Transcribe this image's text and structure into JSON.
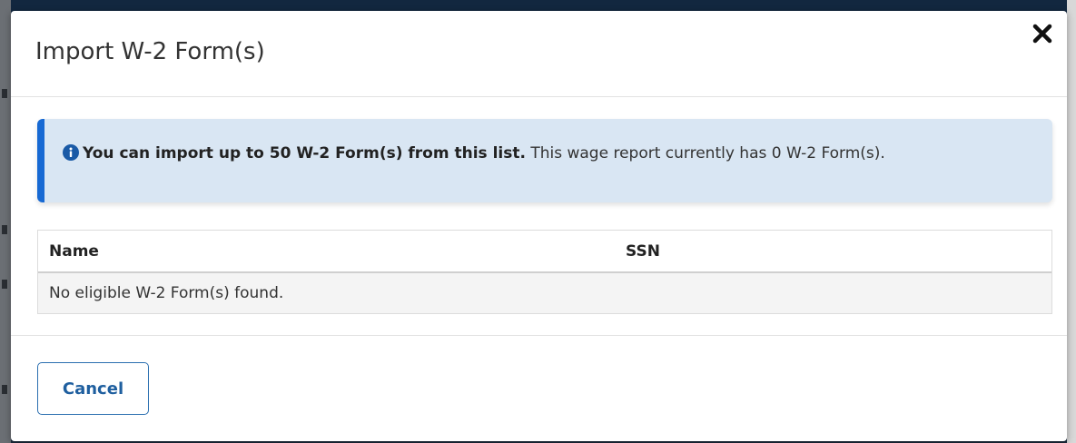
{
  "dialog": {
    "title": "Import W-2 Form(s)",
    "close_icon": "close-icon"
  },
  "alert": {
    "icon": "info-circle-icon",
    "bold_text": "You can import up to 50 W-2 Form(s) from this list.",
    "text": " This wage report currently has 0 W-2 Form(s).",
    "accent_color": "#1769d3",
    "background_color": "#d9e6f3"
  },
  "table": {
    "columns": [
      "Name",
      "SSN"
    ],
    "empty_message": "No eligible W-2 Form(s) found."
  },
  "footer": {
    "cancel_label": "Cancel"
  }
}
